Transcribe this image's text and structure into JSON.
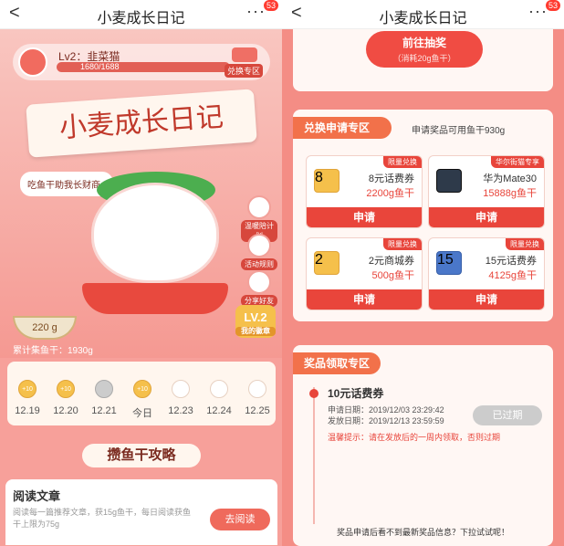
{
  "header": {
    "back": "<",
    "title": "小麦成长日记",
    "more": "···",
    "badge": "53"
  },
  "left": {
    "level": {
      "name": "Lv2：韭菜猫",
      "progress_text": "1680/1688",
      "progress_fraction": 0.9953,
      "shop_label": "兑换专区"
    },
    "banner_title": "小麦成长日记",
    "speech": "吃鱼干助我长财商~",
    "side_buttons": [
      "温暖陪计划",
      "活动规则",
      "分享好友"
    ],
    "level_badge": {
      "level": "LV.2",
      "label": "我的徽章"
    },
    "bowl_amount": "220 g",
    "collected": "累计集鱼干：1930g",
    "calendar": [
      {
        "date": "12.19",
        "state": "on",
        "coin": "+10"
      },
      {
        "date": "12.20",
        "state": "on",
        "coin": "+10"
      },
      {
        "date": "12.21",
        "state": "gray",
        "coin": ""
      },
      {
        "date": "今日",
        "state": "on",
        "coin": "+10"
      },
      {
        "date": "12.23",
        "state": "off",
        "coin": ""
      },
      {
        "date": "12.24",
        "state": "off",
        "coin": ""
      },
      {
        "date": "12.25",
        "state": "off",
        "coin": ""
      }
    ],
    "guide_title": "攒鱼干攻略",
    "task": {
      "title": "阅读文章",
      "desc": "阅读每一篇推荐文章，获15g鱼干，每日阅读获鱼干上限为75g",
      "button": "去阅读"
    }
  },
  "right": {
    "lottery": {
      "button": "前往抽奖",
      "cost": "（消耗20g鱼干）"
    },
    "exchange": {
      "tag": "兑换申请专区",
      "note": "申请奖品可用鱼干930g",
      "prizes": [
        {
          "tag": "限量兑换",
          "name": "8元话费券",
          "price": "2200g鱼干",
          "thumb_label": "8",
          "button": "申请"
        },
        {
          "tag": "华尔街猫专享",
          "name": "华为Mate30",
          "price": "15888g鱼干",
          "thumb_label": "",
          "button": "申请"
        },
        {
          "tag": "限量兑换",
          "name": "2元商城券",
          "price": "500g鱼干",
          "thumb_label": "2",
          "button": "申请"
        },
        {
          "tag": "限量兑换",
          "name": "15元话费券",
          "price": "4125g鱼干",
          "thumb_label": "15",
          "button": "申请"
        }
      ]
    },
    "claim": {
      "tag": "奖品领取专区",
      "item": "10元话费券",
      "apply_date": "申请日期：2019/12/03 23:29:42",
      "issue_date": "发放日期：2019/12/13 23:59:59",
      "status": "已过期",
      "warning": "温馨提示：请在发放后的一周内领取，否则过期",
      "footer": "奖品申请后看不到最新奖品信息？下拉试试呢！"
    }
  }
}
